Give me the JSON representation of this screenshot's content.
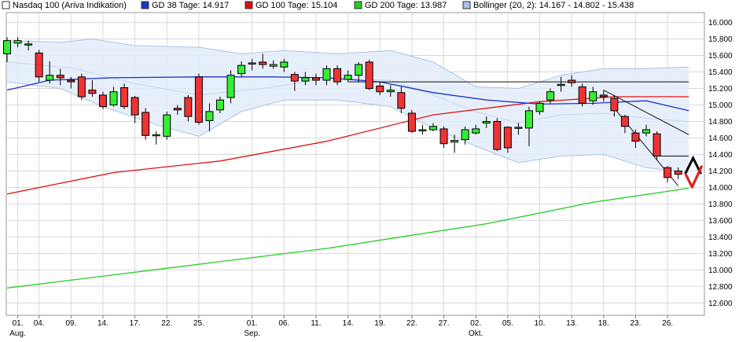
{
  "chart_data": {
    "type": "candlestick",
    "legend": [
      {
        "label": "Nasdaq 100 (Ariva Indikation)",
        "color": "#ffffff"
      },
      {
        "label": "GD 38 Tage: 14.917",
        "color": "#1a33cc"
      },
      {
        "label": "GD 100 Tage: 15.104",
        "color": "#dd1111"
      },
      {
        "label": "GD 200 Tage: 13.987",
        "color": "#22cc22"
      },
      {
        "label": "Bollinger (20, 2): 14.167 - 14.802 - 15.438",
        "color": "#a9c3e6"
      }
    ],
    "y_ticks": [
      "16.000",
      "15.800",
      "15.600",
      "15.400",
      "15.200",
      "15.000",
      "14.800",
      "14.600",
      "14.400",
      "14.200",
      "14.000",
      "13.800",
      "13.600",
      "13.400",
      "13.200",
      "13.000",
      "12.800",
      "12.600"
    ],
    "ylim": [
      12.45,
      16.12
    ],
    "x_ticks": [
      {
        "label": "01.",
        "sub": "Aug.",
        "i": 1
      },
      {
        "label": "04.",
        "sub": "",
        "i": 3
      },
      {
        "label": "09.",
        "sub": "",
        "i": 6
      },
      {
        "label": "14.",
        "sub": "",
        "i": 9
      },
      {
        "label": "17.",
        "sub": "",
        "i": 12
      },
      {
        "label": "22.",
        "sub": "",
        "i": 15
      },
      {
        "label": "25.",
        "sub": "",
        "i": 18
      },
      {
        "label": "01.",
        "sub": "Sep.",
        "i": 23
      },
      {
        "label": "06.",
        "sub": "",
        "i": 26
      },
      {
        "label": "11.",
        "sub": "",
        "i": 29
      },
      {
        "label": "14.",
        "sub": "",
        "i": 32
      },
      {
        "label": "19.",
        "sub": "",
        "i": 35
      },
      {
        "label": "22.",
        "sub": "",
        "i": 38
      },
      {
        "label": "27.",
        "sub": "",
        "i": 41
      },
      {
        "label": "02.",
        "sub": "Okt.",
        "i": 44
      },
      {
        "label": "05.",
        "sub": "",
        "i": 47
      },
      {
        "label": "10.",
        "sub": "",
        "i": 50
      },
      {
        "label": "13.",
        "sub": "",
        "i": 53
      },
      {
        "label": "18.",
        "sub": "",
        "i": 56
      },
      {
        "label": "23.",
        "sub": "",
        "i": 59
      },
      {
        "label": "26.",
        "sub": "",
        "i": 62
      }
    ],
    "candles": [
      [
        15.62,
        15.78,
        15.82,
        15.52
      ],
      [
        15.75,
        15.78,
        15.82,
        15.7
      ],
      [
        15.74,
        15.74,
        15.78,
        15.66
      ],
      [
        15.63,
        15.34,
        15.67,
        15.28
      ],
      [
        15.3,
        15.36,
        15.53,
        15.26
      ],
      [
        15.36,
        15.33,
        15.44,
        15.24
      ],
      [
        15.3,
        15.28,
        15.34,
        15.2
      ],
      [
        15.34,
        15.1,
        15.38,
        15.06
      ],
      [
        15.18,
        15.14,
        15.3,
        15.1
      ],
      [
        15.12,
        14.98,
        15.16,
        14.95
      ],
      [
        15.0,
        15.16,
        15.22,
        14.98
      ],
      [
        15.21,
        14.98,
        15.26,
        14.95
      ],
      [
        15.09,
        14.88,
        15.11,
        14.78
      ],
      [
        14.91,
        14.63,
        14.96,
        14.58
      ],
      [
        14.64,
        14.64,
        14.68,
        14.52
      ],
      [
        14.62,
        14.88,
        14.92,
        14.58
      ],
      [
        14.96,
        14.94,
        15.0,
        14.88
      ],
      [
        15.09,
        14.86,
        15.12,
        14.8
      ],
      [
        15.34,
        14.79,
        15.38,
        14.76
      ],
      [
        14.81,
        14.92,
        15.02,
        14.68
      ],
      [
        14.94,
        15.06,
        15.1,
        14.9
      ],
      [
        15.09,
        15.36,
        15.42,
        15.02
      ],
      [
        15.38,
        15.48,
        15.53,
        15.34
      ],
      [
        15.5,
        15.51,
        15.56,
        15.42
      ],
      [
        15.52,
        15.49,
        15.62,
        15.44
      ],
      [
        15.47,
        15.49,
        15.54,
        15.44
      ],
      [
        15.46,
        15.52,
        15.56,
        15.4
      ],
      [
        15.37,
        15.29,
        15.4,
        15.17
      ],
      [
        15.29,
        15.33,
        15.4,
        15.24
      ],
      [
        15.33,
        15.3,
        15.38,
        15.24
      ],
      [
        15.3,
        15.44,
        15.48,
        15.24
      ],
      [
        15.44,
        15.28,
        15.48,
        15.24
      ],
      [
        15.31,
        15.36,
        15.42,
        15.28
      ],
      [
        15.36,
        15.49,
        15.52,
        15.28
      ],
      [
        15.52,
        15.2,
        15.55,
        15.18
      ],
      [
        15.23,
        15.16,
        15.28,
        15.12
      ],
      [
        15.16,
        15.18,
        15.24,
        15.1
      ],
      [
        15.15,
        14.96,
        15.22,
        14.9
      ],
      [
        14.9,
        14.68,
        14.94,
        14.66
      ],
      [
        14.7,
        14.7,
        14.76,
        14.64
      ],
      [
        14.7,
        14.74,
        14.78,
        14.68
      ],
      [
        14.71,
        14.53,
        14.74,
        14.48
      ],
      [
        14.55,
        14.57,
        14.64,
        14.42
      ],
      [
        14.58,
        14.7,
        14.74,
        14.52
      ],
      [
        14.66,
        14.71,
        14.76,
        14.64
      ],
      [
        14.78,
        14.8,
        14.86,
        14.72
      ],
      [
        14.8,
        14.46,
        14.84,
        14.44
      ],
      [
        14.73,
        14.48,
        14.74,
        14.42
      ],
      [
        14.73,
        14.73,
        14.78,
        14.64
      ],
      [
        14.72,
        14.93,
        14.98,
        14.5
      ],
      [
        14.92,
        15.02,
        15.04,
        14.88
      ],
      [
        15.06,
        15.16,
        15.2,
        15.02
      ],
      [
        15.24,
        15.25,
        15.34,
        15.16
      ],
      [
        15.3,
        15.27,
        15.36,
        15.22
      ],
      [
        15.22,
        15.02,
        15.26,
        14.98
      ],
      [
        15.05,
        15.16,
        15.22,
        15.0
      ],
      [
        15.12,
        15.1,
        15.18,
        15.04
      ],
      [
        15.08,
        14.93,
        15.12,
        14.86
      ],
      [
        14.86,
        14.74,
        14.88,
        14.66
      ],
      [
        14.66,
        14.56,
        14.7,
        14.48
      ],
      [
        14.66,
        14.7,
        14.76,
        14.62
      ],
      [
        14.65,
        14.38,
        14.68,
        14.34
      ],
      [
        14.24,
        14.12,
        14.26,
        14.06
      ],
      [
        14.2,
        14.16,
        14.24,
        14.1
      ]
    ],
    "gd38": [
      [
        0,
        15.18
      ],
      [
        4,
        15.3
      ],
      [
        10,
        15.33
      ],
      [
        18,
        15.34
      ],
      [
        25,
        15.34
      ],
      [
        30,
        15.33
      ],
      [
        35,
        15.28
      ],
      [
        40,
        15.15
      ],
      [
        45,
        15.06
      ],
      [
        50,
        15.01
      ],
      [
        55,
        15.02
      ],
      [
        60,
        15.05
      ],
      [
        64,
        14.93
      ]
    ],
    "gd100": [
      [
        0,
        13.92
      ],
      [
        10,
        14.18
      ],
      [
        20,
        14.32
      ],
      [
        30,
        14.56
      ],
      [
        40,
        14.88
      ],
      [
        50,
        15.04
      ],
      [
        57,
        15.1
      ],
      [
        64,
        15.1
      ]
    ],
    "gd200": [
      [
        0,
        12.78
      ],
      [
        15,
        13.02
      ],
      [
        30,
        13.26
      ],
      [
        45,
        13.56
      ],
      [
        55,
        13.82
      ],
      [
        64,
        13.99
      ]
    ],
    "boll_upper": [
      [
        0,
        15.78
      ],
      [
        5,
        15.76
      ],
      [
        8,
        15.8
      ],
      [
        12,
        15.72
      ],
      [
        18,
        15.7
      ],
      [
        22,
        15.62
      ],
      [
        26,
        15.66
      ],
      [
        31,
        15.62
      ],
      [
        36,
        15.66
      ],
      [
        40,
        15.52
      ],
      [
        44,
        15.22
      ],
      [
        48,
        15.2
      ],
      [
        52,
        15.36
      ],
      [
        56,
        15.44
      ],
      [
        60,
        15.44
      ],
      [
        64,
        15.46
      ]
    ],
    "boll_lower": [
      [
        0,
        15.28
      ],
      [
        5,
        15.2
      ],
      [
        9,
        14.98
      ],
      [
        14,
        14.76
      ],
      [
        18,
        14.62
      ],
      [
        22,
        14.92
      ],
      [
        26,
        15.06
      ],
      [
        31,
        15.06
      ],
      [
        36,
        14.98
      ],
      [
        40,
        14.72
      ],
      [
        44,
        14.5
      ],
      [
        48,
        14.3
      ],
      [
        52,
        14.38
      ],
      [
        56,
        14.4
      ],
      [
        60,
        14.24
      ],
      [
        64,
        14.18
      ]
    ],
    "boll_mid": [
      [
        0,
        15.52
      ],
      [
        6,
        15.45
      ],
      [
        12,
        15.26
      ],
      [
        18,
        15.12
      ],
      [
        24,
        15.2
      ],
      [
        30,
        15.32
      ],
      [
        36,
        15.3
      ],
      [
        40,
        15.12
      ],
      [
        44,
        14.92
      ],
      [
        48,
        14.78
      ],
      [
        52,
        14.88
      ],
      [
        56,
        14.9
      ],
      [
        60,
        14.84
      ],
      [
        64,
        14.8
      ]
    ],
    "trendlines": [
      {
        "from": [
          32,
          15.28
        ],
        "to": [
          64,
          15.28
        ]
      },
      {
        "from": [
          56,
          15.18
        ],
        "to": [
          64,
          14.64
        ]
      },
      {
        "from": [
          57,
          14.96
        ],
        "to": [
          63,
          14.02
        ]
      },
      {
        "from": [
          61,
          14.38
        ],
        "to": [
          64,
          14.38
        ]
      }
    ],
    "signal_marks": {
      "up": [
        64.4,
        14.28
      ],
      "check": [
        64.6,
        14.1
      ]
    }
  }
}
